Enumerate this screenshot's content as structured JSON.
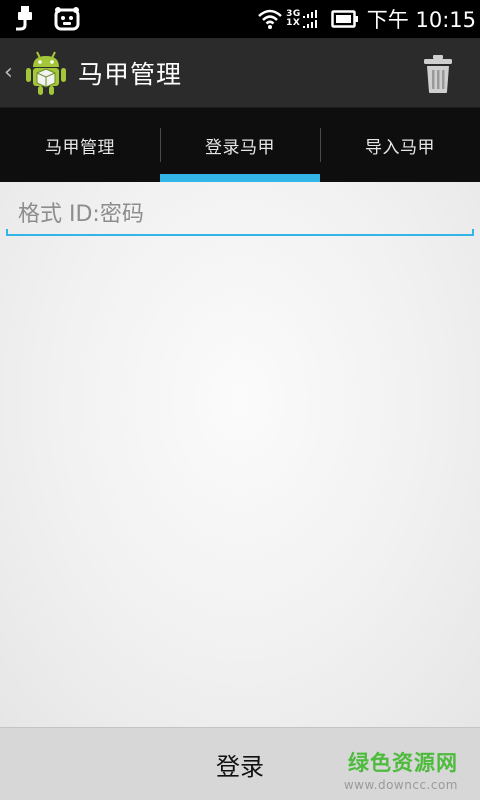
{
  "status_bar": {
    "network_3g": "3G",
    "network_1x": "1X",
    "time": "下午 10:15",
    "icons": [
      "usb-icon",
      "notification-app-icon",
      "wifi-icon",
      "signal-icon",
      "battery-icon"
    ]
  },
  "action_bar": {
    "up_caret": "‹",
    "title": "马甲管理",
    "app_icon": "android-robot-icon",
    "action_icon": "trash-icon"
  },
  "tabs": [
    {
      "label": "马甲管理",
      "active": false
    },
    {
      "label": "登录马甲",
      "active": true
    },
    {
      "label": "导入马甲",
      "active": false
    }
  ],
  "form": {
    "account_input": {
      "placeholder": "格式 ID:密码",
      "value": ""
    }
  },
  "bottom_bar": {
    "login_label": "登录"
  },
  "watermark": {
    "main": "绿色资源网",
    "sub": "www.downcc.com"
  },
  "colors": {
    "accent": "#33b5e5",
    "status_bar": "#000000",
    "action_bar": "#2b2b2b",
    "tab_bar": "#0e0e0e",
    "watermark": "#4dbb3c"
  }
}
